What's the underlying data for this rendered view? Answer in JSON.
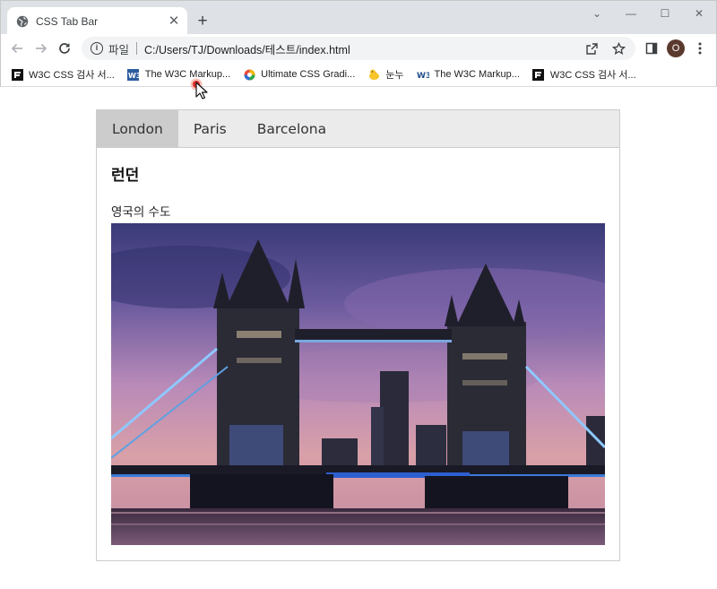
{
  "browser": {
    "tab_title": "CSS Tab Bar",
    "tab_close": "✕",
    "new_tab": "+",
    "window_controls": {
      "collapse": "⌄",
      "minimize": "—",
      "maximize": "☐",
      "close": "✕"
    },
    "omnibox": {
      "info_icon": "i",
      "scheme_label": "파일",
      "url": "C:/Users/TJ/Downloads/테스트/index.html"
    },
    "profile_initial": "O",
    "bookmarks": [
      {
        "icon": "w3c-css-icon",
        "label": "W3C CSS 검사 서..."
      },
      {
        "icon": "w3c-markup-icon",
        "label": "The W3C Markup..."
      },
      {
        "icon": "gradient-icon",
        "label": "Ultimate CSS Gradi..."
      },
      {
        "icon": "duck-icon",
        "label": "눈누"
      },
      {
        "icon": "w3-icon",
        "label": "The W3C Markup..."
      },
      {
        "icon": "w3c-css-icon",
        "label": "W3C CSS 검사 서..."
      }
    ]
  },
  "page": {
    "tabs": [
      {
        "label": "London",
        "active": true
      },
      {
        "label": "Paris",
        "active": false
      },
      {
        "label": "Barcelona",
        "active": false
      }
    ],
    "content": {
      "title": "런던",
      "description": "영국의 수도",
      "image_subject": "tower-bridge-photo"
    }
  }
}
